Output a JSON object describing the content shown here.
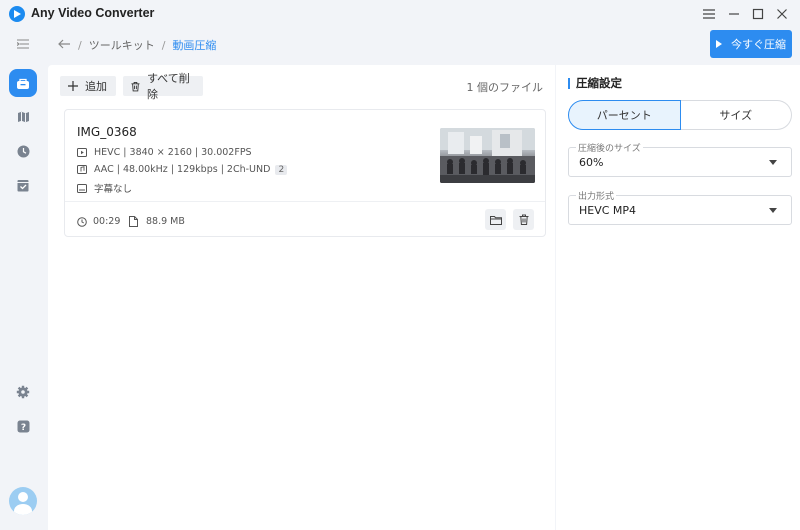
{
  "app": {
    "title": "Any Video Converter"
  },
  "breadcrumb": {
    "items": [
      "ツールキット",
      "動画圧縮"
    ]
  },
  "header": {
    "compress_label": "今すぐ圧縮"
  },
  "toolbar": {
    "add_label": "追加",
    "clear_label": "すべて削除",
    "file_count": "1 個のファイル"
  },
  "file": {
    "name": "IMG_0368",
    "video": "HEVC | 3840 × 2160 | 30.002FPS",
    "audio": "AAC | 48.00kHz | 129kbps | 2Ch-UND",
    "audio_tracks": "2",
    "subtitle": "字幕なし",
    "duration": "00:29",
    "size": "88.9 MB"
  },
  "settings": {
    "title": "圧縮設定",
    "mode_tabs": [
      "パーセント",
      "サイズ"
    ],
    "active_mode": "パーセント",
    "target_label": "圧縮後のサイズ",
    "target_value": "60%",
    "format_label": "出力形式",
    "format_value": "HEVC MP4"
  },
  "colors": {
    "accent": "#2d8cf0",
    "background": "#f2f4f8"
  }
}
